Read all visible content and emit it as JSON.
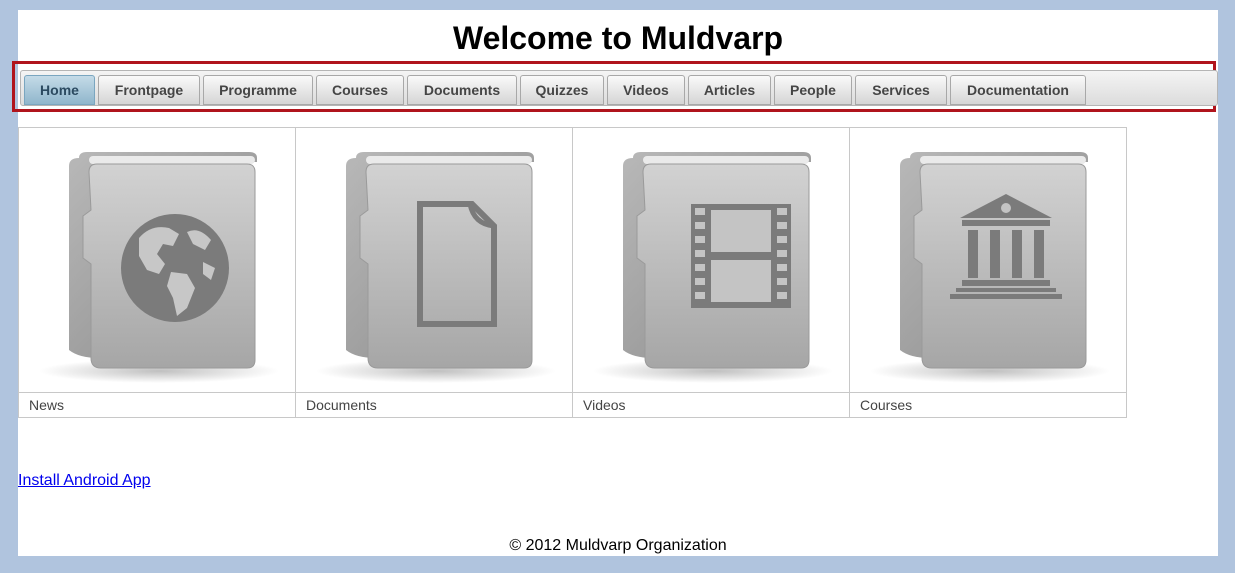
{
  "header": {
    "title": "Welcome to Muldvarp"
  },
  "nav": {
    "tabs": [
      {
        "label": "Home",
        "active": true
      },
      {
        "label": "Frontpage"
      },
      {
        "label": "Programme"
      },
      {
        "label": "Courses"
      },
      {
        "label": "Documents"
      },
      {
        "label": "Quizzes"
      },
      {
        "label": "Videos"
      },
      {
        "label": "Articles"
      },
      {
        "label": "People"
      },
      {
        "label": "Services"
      },
      {
        "label": "Documentation"
      }
    ]
  },
  "tiles": [
    {
      "label": "News",
      "icon": "globe-icon"
    },
    {
      "label": "Documents",
      "icon": "document-icon"
    },
    {
      "label": "Videos",
      "icon": "film-icon"
    },
    {
      "label": "Courses",
      "icon": "institution-icon"
    }
  ],
  "links": {
    "android": "Install Android App"
  },
  "footer": {
    "copyright": "© 2012 Muldvarp Organization"
  },
  "colors": {
    "background": "#b0c4de",
    "active_tab": "#8fb6cc",
    "highlight_border": "#b0141c"
  }
}
